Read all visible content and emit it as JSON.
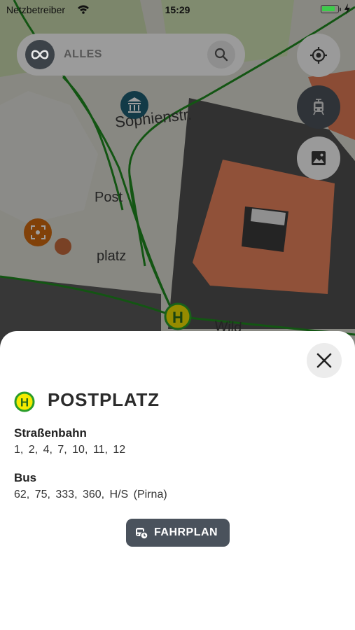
{
  "status_bar": {
    "carrier": "Netzbetreiber",
    "time": "15:29",
    "battery_level": 0.85
  },
  "map": {
    "street_labels": [
      "Sophienstr.",
      "Post",
      "platz",
      "Wild"
    ],
    "poi_icons": [
      "museum-icon",
      "attraction-icon"
    ],
    "stop_marker_letter": "H",
    "colors": {
      "tram_line": "#1f8a1f",
      "building_roof": "#e8835c",
      "museum_marker": "#1e5e73",
      "attraction_marker": "#d06a10",
      "stop_marker": "#f0e000"
    }
  },
  "search": {
    "mode_label": "ALLES"
  },
  "controls": [
    "locate-icon",
    "tram-icon",
    "image-icon"
  ],
  "stop": {
    "icon_letter": "H",
    "name": "POSTPLATZ",
    "tram": {
      "heading": "Straßenbahn",
      "lines": "1,  2,  4,  7,  10,  11,  12"
    },
    "bus": {
      "heading": "Bus",
      "lines": "62,  75,  333,  360,  H/S (Pirna)"
    },
    "schedule_button": "FAHRPLAN"
  },
  "colors": {
    "accent_dark": "#4a525c",
    "stop_yellow": "#f4ea00",
    "stop_green": "#2a9d2a"
  }
}
